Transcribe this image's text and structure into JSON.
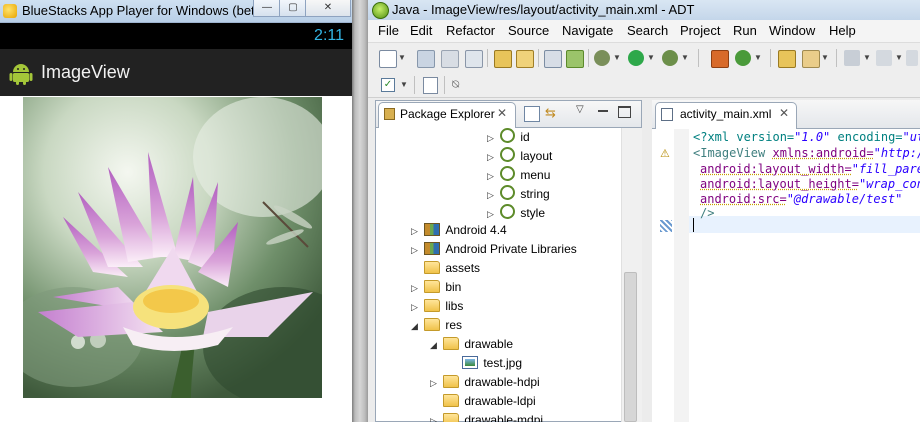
{
  "bluestacks": {
    "window_title": "BlueStacks App Player for Windows (bet...",
    "status_time": "2:11",
    "app_title": "ImageView"
  },
  "adt": {
    "window_title": "Java - ImageView/res/layout/activity_main.xml - ADT",
    "menu": [
      "File",
      "Edit",
      "Refactor",
      "Source",
      "Navigate",
      "Search",
      "Project",
      "Run",
      "Window",
      "Help"
    ],
    "package_explorer": {
      "tab_label": "Package Explorer",
      "tree": [
        {
          "label": "id",
          "icon": "values-icon",
          "arrow": "▷"
        },
        {
          "label": "layout",
          "icon": "values-icon",
          "arrow": "▷"
        },
        {
          "label": "menu",
          "icon": "values-icon",
          "arrow": "▷"
        },
        {
          "label": "string",
          "icon": "values-icon",
          "arrow": "▷"
        },
        {
          "label": "style",
          "icon": "values-icon",
          "arrow": "▷"
        },
        {
          "label": "Android 4.4",
          "icon": "library-icon",
          "arrow": "▷"
        },
        {
          "label": "Android Private Libraries",
          "icon": "library-icon",
          "arrow": "▷"
        },
        {
          "label": "assets",
          "icon": "folder-icon",
          "arrow": ""
        },
        {
          "label": "bin",
          "icon": "folder-icon",
          "arrow": "▷"
        },
        {
          "label": "libs",
          "icon": "folder-icon",
          "arrow": "▷"
        },
        {
          "label": "res",
          "icon": "folder-icon",
          "arrow": "◢"
        },
        {
          "label": "drawable",
          "icon": "folder-icon",
          "arrow": "◢"
        },
        {
          "label": "test.jpg",
          "icon": "image-file-icon",
          "arrow": ""
        },
        {
          "label": "drawable-hdpi",
          "icon": "folder-icon",
          "arrow": "▷"
        },
        {
          "label": "drawable-ldpi",
          "icon": "folder-icon",
          "arrow": ""
        },
        {
          "label": "drawable-mdpi",
          "icon": "folder-icon",
          "arrow": "▷"
        }
      ]
    },
    "editor": {
      "tab_label": "activity_main.xml",
      "lines": {
        "l1a": "<?xml version=",
        "l1b": "\"1.0\"",
        "l1c": " encoding=",
        "l1d": "\"utf",
        "l2a": "<ImageView ",
        "l2b": "xmlns:android=",
        "l2c": "\"http://",
        "l3a": "android:layout_width=",
        "l3b": "\"fill_parent",
        "l4a": "android:layout_height=",
        "l4b": "\"wrap_conte",
        "l5a": "android:src=",
        "l5b": "\"@drawable/test\"",
        "l6a": "/>"
      }
    }
  }
}
